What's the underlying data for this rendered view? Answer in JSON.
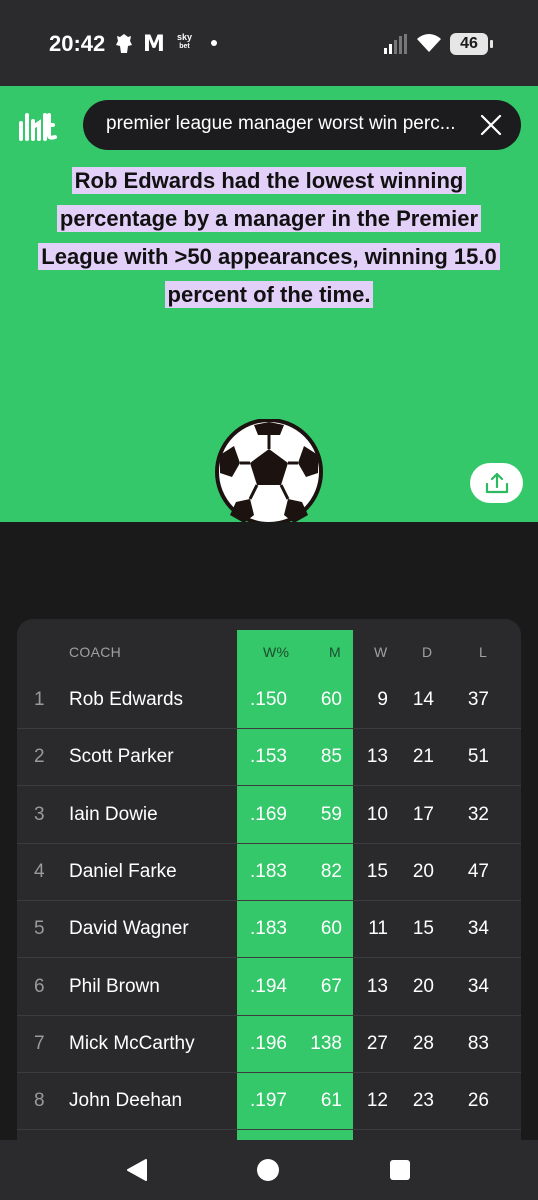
{
  "status_bar": {
    "time": "20:42",
    "sky_label": "sky",
    "sky_sub": "bet",
    "battery": "46",
    "icons": [
      "premier-league-icon",
      "m-icon",
      "sky-bet-icon",
      "dot-icon",
      "signal-icon",
      "wifi-icon",
      "battery-icon"
    ]
  },
  "search": {
    "query": "premier league manager worst win perc..."
  },
  "headline": {
    "line1": "Rob Edwards had the lowest winning",
    "line2": "percentage by a manager in the Premier",
    "line3": "League with >50 appearances, winning 15.0",
    "line4": "percent of the time."
  },
  "colors": {
    "accent_green": "#34c86a",
    "highlight_lavender": "#e3d0f9",
    "card_bg": "#2a2a2c"
  },
  "table": {
    "headers": {
      "coach": "COACH",
      "wpct": "W%",
      "m": "M",
      "w": "W",
      "d": "D",
      "l": "L"
    },
    "rows": [
      {
        "rank": "1",
        "coach": "Rob Edwards",
        "wpct": ".150",
        "m": "60",
        "w": "9",
        "d": "14",
        "l": "37"
      },
      {
        "rank": "2",
        "coach": "Scott Parker",
        "wpct": ".153",
        "m": "85",
        "w": "13",
        "d": "21",
        "l": "51"
      },
      {
        "rank": "3",
        "coach": "Iain Dowie",
        "wpct": ".169",
        "m": "59",
        "w": "10",
        "d": "17",
        "l": "32"
      },
      {
        "rank": "4",
        "coach": "Daniel Farke",
        "wpct": ".183",
        "m": "82",
        "w": "15",
        "d": "20",
        "l": "47"
      },
      {
        "rank": "5",
        "coach": "David Wagner",
        "wpct": ".183",
        "m": "60",
        "w": "11",
        "d": "15",
        "l": "34"
      },
      {
        "rank": "6",
        "coach": "Phil Brown",
        "wpct": ".194",
        "m": "67",
        "w": "13",
        "d": "20",
        "l": "34"
      },
      {
        "rank": "7",
        "coach": "Mick McCarthy",
        "wpct": ".196",
        "m": "138",
        "w": "27",
        "d": "28",
        "l": "83"
      },
      {
        "rank": "8",
        "coach": "John Deehan",
        "wpct": ".197",
        "m": "61",
        "w": "12",
        "d": "23",
        "l": "26"
      }
    ],
    "overflow_hint": "1"
  }
}
